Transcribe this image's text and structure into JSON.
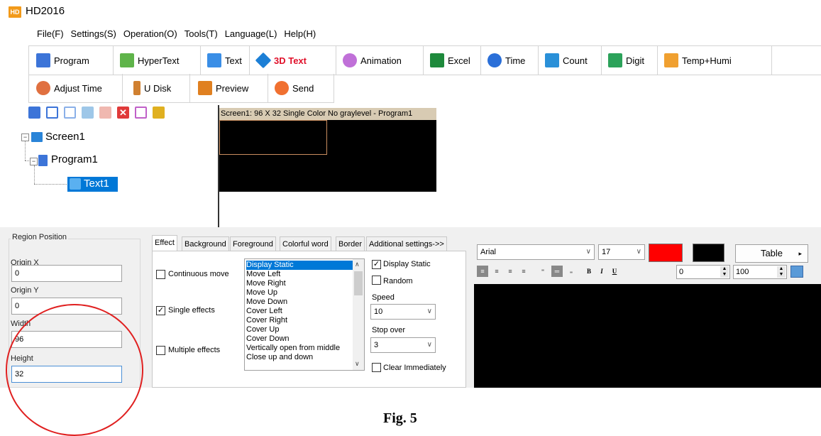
{
  "app": {
    "icon_text": "HD",
    "title": "HD2016"
  },
  "menu": [
    "File(F)",
    "Settings(S)",
    "Operation(O)",
    "Tools(T)",
    "Language(L)",
    "Help(H)"
  ],
  "toolbar1": [
    {
      "label": "Program",
      "icon": "program-icon",
      "color": "#3c74d8"
    },
    {
      "label": "HyperText",
      "icon": "hypertext-icon",
      "color": "#5fb44a"
    },
    {
      "label": "Text",
      "icon": "text-icon",
      "color": "#3a8ee6"
    },
    {
      "label": "3D Text",
      "icon": "3d-text-icon",
      "color": "#1c7fd6"
    },
    {
      "label": "Animation",
      "icon": "animation-icon",
      "color": "#c070d8"
    },
    {
      "label": "Excel",
      "icon": "excel-icon",
      "color": "#1e8a3c"
    },
    {
      "label": "Time",
      "icon": "time-icon",
      "color": "#2a6fd8"
    },
    {
      "label": "Count",
      "icon": "count-icon",
      "color": "#2a90d8"
    },
    {
      "label": "Digit",
      "icon": "digit-icon",
      "color": "#2ca25a"
    },
    {
      "label": "Temp+Humi",
      "icon": "temp-humi-icon",
      "color": "#f0a030"
    }
  ],
  "toolbar2": [
    {
      "label": "Adjust Time",
      "icon": "adjust-time-icon",
      "color": "#e07040"
    },
    {
      "label": "U Disk",
      "icon": "u-disk-icon",
      "color": "#d08030"
    },
    {
      "label": "Preview",
      "icon": "preview-icon",
      "color": "#e08020"
    },
    {
      "label": "Send",
      "icon": "send-icon",
      "color": "#f07030"
    }
  ],
  "tree": {
    "screen": "Screen1",
    "program": "Program1",
    "text": "Text1"
  },
  "preview": {
    "header": "Screen1: 96 X 32  Single Color No graylevel - Program1"
  },
  "region": {
    "title": "Region Position",
    "origin_x_label": "Origin X",
    "origin_x": "0",
    "origin_y_label": "Origin Y",
    "origin_y": "0",
    "width_label": "Width",
    "width": "96",
    "height_label": "Height",
    "height": "32"
  },
  "tabs": [
    "Effect",
    "Background",
    "Foreground",
    "Colorful word",
    "Border",
    "Additional settings->>"
  ],
  "effect": {
    "continuous_move": "Continuous move",
    "single_effects": "Single effects",
    "multiple_effects": "Multiple effects",
    "list": [
      "Display Static",
      "Move Left",
      "Move Right",
      "Move Up",
      "Move Down",
      "Cover Left",
      "Cover Right",
      "Cover Up",
      "Cover Down",
      "Vertically open from middle",
      "Close up and down"
    ],
    "display_static": "Display Static",
    "random": "Random",
    "speed_label": "Speed",
    "speed": "10",
    "stop_over_label": "Stop over",
    "stop_over": "3",
    "clear_immediately": "Clear Immediately"
  },
  "editor": {
    "font": "Arial",
    "size": "17",
    "fg_color": "#ff0000",
    "bg_color": "#000000",
    "table_label": "Table",
    "spacing": "0",
    "scale": "100",
    "bold": "B",
    "italic": "I",
    "underline": "U"
  },
  "caption": "Fig. 5",
  "colors": {
    "annotation": "#e02020",
    "selection": "#0078d7"
  }
}
